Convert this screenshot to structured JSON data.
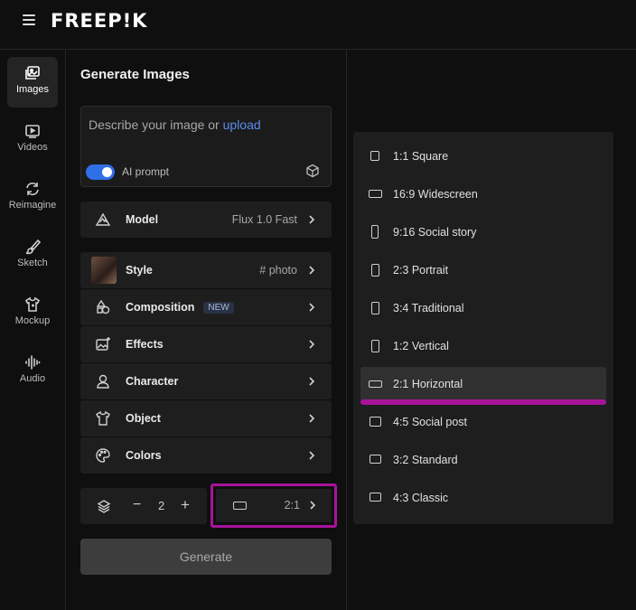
{
  "header": {
    "logo": "FREEP!K"
  },
  "nav": {
    "items": [
      {
        "label": "Images",
        "icon": "images-icon"
      },
      {
        "label": "Videos",
        "icon": "video-icon"
      },
      {
        "label": "Reimagine",
        "icon": "refresh-icon"
      },
      {
        "label": "Sketch",
        "icon": "brush-icon"
      },
      {
        "label": "Mockup",
        "icon": "shirt-icon"
      },
      {
        "label": "Audio",
        "icon": "waveform-icon"
      }
    ],
    "active": "Images"
  },
  "panel": {
    "title": "Generate Images",
    "prompt": {
      "placeholder": "Describe your image or ",
      "upload_link": "upload"
    },
    "ai_prompt": {
      "label": "AI prompt",
      "enabled": true
    },
    "model": {
      "label": "Model",
      "value": "Flux 1.0 Fast"
    },
    "options": [
      {
        "label": "Style",
        "value": "# photo"
      },
      {
        "label": "Composition",
        "badge": "NEW"
      },
      {
        "label": "Effects"
      },
      {
        "label": "Character"
      },
      {
        "label": "Object"
      },
      {
        "label": "Colors"
      }
    ],
    "count": {
      "value": "2",
      "minus": "−",
      "plus": "+"
    },
    "aspect": {
      "value": "2:1"
    },
    "generate": "Generate"
  },
  "aspect_menu": {
    "selected": "2:1 Horizontal",
    "options": [
      "1:1 Square",
      "16:9 Widescreen",
      "9:16 Social story",
      "2:3 Portrait",
      "3:4 Traditional",
      "1:2 Vertical",
      "2:1 Horizontal",
      "4:5 Social post",
      "3:2 Standard",
      "4:3 Classic"
    ]
  },
  "colors": {
    "accent": "#2f6fe8",
    "highlight": "#a8139a",
    "link": "#5b8def"
  }
}
